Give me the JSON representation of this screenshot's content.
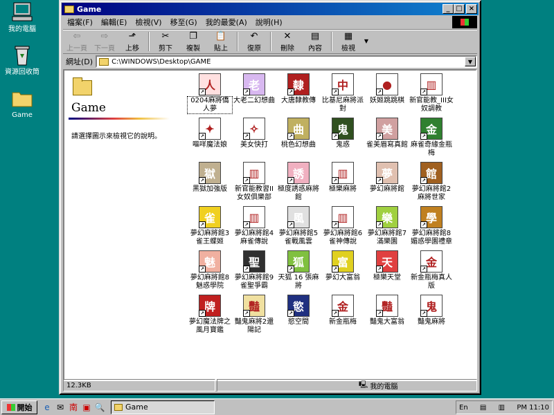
{
  "desktop": {
    "icons": [
      {
        "label": "我的電腦",
        "icon": "computer-icon"
      },
      {
        "label": "資源回收筒",
        "icon": "recycle-bin-icon"
      },
      {
        "label": "Game",
        "icon": "folder-icon"
      }
    ]
  },
  "window": {
    "title": "Game",
    "menu": [
      "檔案(F)",
      "編輯(E)",
      "檢視(V)",
      "移至(G)",
      "我的最愛(A)",
      "說明(H)"
    ],
    "toolbar": [
      {
        "label": "上一頁",
        "icon": "back-arrow-icon",
        "disabled": true
      },
      {
        "label": "下一頁",
        "icon": "forward-arrow-icon",
        "disabled": true
      },
      {
        "label": "上移",
        "icon": "up-folder-icon"
      },
      {
        "label": "剪下",
        "icon": "scissors-icon"
      },
      {
        "label": "複製",
        "icon": "copy-icon"
      },
      {
        "label": "貼上",
        "icon": "paste-icon"
      },
      {
        "label": "復原",
        "icon": "undo-icon"
      },
      {
        "label": "刪除",
        "icon": "delete-x-icon"
      },
      {
        "label": "內容",
        "icon": "properties-icon"
      },
      {
        "label": "檢視",
        "icon": "views-icon"
      }
    ],
    "address": {
      "label": "網址(D)",
      "value": "C:\\WINDOWS\\Desktop\\GAME"
    },
    "sidebar": {
      "title": "Game",
      "description": "請選擇圖示來檢視它的說明。"
    },
    "items": [
      {
        "label": "0204麻將僑人夢",
        "color": "#ffe0e0",
        "glyph": "人"
      },
      {
        "label": "大老二幻想曲",
        "color": "#d8b8f0",
        "glyph": "老"
      },
      {
        "label": "大唐隸教傳",
        "color": "#b02020",
        "glyph": "隸"
      },
      {
        "label": "比基尼麻將派對",
        "color": "#ffffff",
        "glyph": "中"
      },
      {
        "label": "妖姬跳跳棋",
        "color": "#ffffff",
        "glyph": "●"
      },
      {
        "label": "新官能教_III女奴調教",
        "color": "#ffffff",
        "glyph": "▥"
      },
      {
        "label": "嘔咩魔法娘",
        "color": "#ffffff",
        "glyph": "✦"
      },
      {
        "label": "美女快打",
        "color": "#ffffff",
        "glyph": "✧"
      },
      {
        "label": "桃色幻想曲",
        "color": "#c0b060",
        "glyph": "曲"
      },
      {
        "label": "鬼惑",
        "color": "#305020",
        "glyph": "鬼"
      },
      {
        "label": "雀美眉寫真館",
        "color": "#d0a0a0",
        "glyph": "美"
      },
      {
        "label": "麻雀奇緣金瓶梅",
        "color": "#308030",
        "glyph": "金"
      },
      {
        "label": "黑獄加強版",
        "color": "#c0b090",
        "glyph": "獄"
      },
      {
        "label": "新官能教習II女奴俱樂部",
        "color": "#ffffff",
        "glyph": "▥"
      },
      {
        "label": "極度誘惑麻將館",
        "color": "#f0b0c0",
        "glyph": "誘"
      },
      {
        "label": "極樂麻將",
        "color": "#ffffff",
        "glyph": "▥"
      },
      {
        "label": "夢幻麻將館",
        "color": "#e0c0b0",
        "glyph": "夢"
      },
      {
        "label": "夢幻麻將館2麻將世家",
        "color": "#a06020",
        "glyph": "館"
      },
      {
        "label": "夢幻麻將館3雀王蝶姬",
        "color": "#f0d020",
        "glyph": "雀"
      },
      {
        "label": "夢幻麻將館4麻雀傳說",
        "color": "#ffffff",
        "glyph": "▥"
      },
      {
        "label": "夢幻麻將館5雀戰風雲",
        "color": "#e0e0e0",
        "glyph": "風"
      },
      {
        "label": "夢幻麻將館6雀神傳說",
        "color": "#ffffff",
        "glyph": "▥"
      },
      {
        "label": "夢幻麻將館7滿樂園",
        "color": "#a0d040",
        "glyph": "樂"
      },
      {
        "label": "夢幻麻將館8媚惑學園禮章",
        "color": "#c08020",
        "glyph": "學"
      },
      {
        "label": "夢幻麻將館8魅惑學院",
        "color": "#f0b0a0",
        "glyph": "魅"
      },
      {
        "label": "夢幻麻將館9雀聖爭霸",
        "color": "#303030",
        "glyph": "聖"
      },
      {
        "label": "天狐 16 張麻將",
        "color": "#80c040",
        "glyph": "狐"
      },
      {
        "label": "夢幻大富翁",
        "color": "#e0d020",
        "glyph": "富"
      },
      {
        "label": "極樂天堂",
        "color": "#e04040",
        "glyph": "天"
      },
      {
        "label": "新金瓶梅真人版",
        "color": "#ffffff",
        "glyph": "金"
      },
      {
        "label": "夢幻魔法牌之風月寶鑑",
        "color": "#c02020",
        "glyph": "牌"
      },
      {
        "label": "豔鬼麻將2還陽記",
        "color": "#f0e0a0",
        "glyph": "豔"
      },
      {
        "label": "慾空間",
        "color": "#203080",
        "glyph": "慾"
      },
      {
        "label": "新金瓶梅",
        "color": "#ffffff",
        "glyph": "金"
      },
      {
        "label": "豔鬼大富翁",
        "color": "#ffffff",
        "glyph": "豔"
      },
      {
        "label": "豔鬼麻將",
        "color": "#ffffff",
        "glyph": "鬼"
      }
    ],
    "status": {
      "size": "12.3KB",
      "location": "我的電腦"
    }
  },
  "taskbar": {
    "start": "開始",
    "task": "Game",
    "tray": {
      "time": "PM 11:10",
      "lang": "En"
    }
  }
}
